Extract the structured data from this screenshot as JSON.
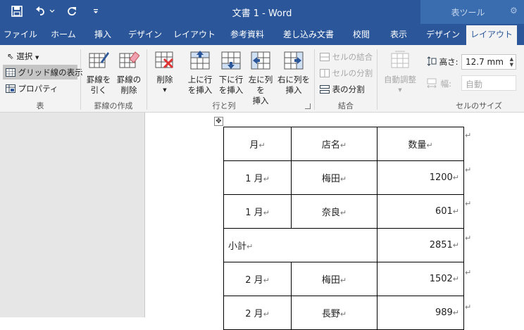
{
  "titlebar": {
    "doc_title": "文書 1 - Word",
    "context_title": "表ツール"
  },
  "tabs": [
    {
      "label": "ファイル"
    },
    {
      "label": "ホーム"
    },
    {
      "label": "挿入"
    },
    {
      "label": "デザイン"
    },
    {
      "label": "レイアウト"
    },
    {
      "label": "参考資料"
    },
    {
      "label": "差し込み文書"
    },
    {
      "label": "校閲"
    },
    {
      "label": "表示"
    },
    {
      "label": "デザイン"
    },
    {
      "label": "レイアウト"
    }
  ],
  "ribbon": {
    "table_group": {
      "select": "選択",
      "gridlines": "グリッド線の表示",
      "properties": "プロパティ",
      "label": "表"
    },
    "draw_group": {
      "draw_line": [
        "罫線を",
        "引く"
      ],
      "erase_line": [
        "罫線の",
        "削除"
      ],
      "label": "罫線の作成"
    },
    "rows_cols_group": {
      "delete": "削除",
      "insert_above": [
        "上に行",
        "を挿入"
      ],
      "insert_below": [
        "下に行",
        "を挿入"
      ],
      "insert_left": [
        "左に列を",
        "挿入"
      ],
      "insert_right": [
        "右に列を",
        "挿入"
      ],
      "label": "行と列"
    },
    "merge_group": {
      "merge_cells": "セルの結合",
      "split_cells": "セルの分割",
      "split_table": "表の分割",
      "label": "結合"
    },
    "cell_size_group": {
      "autofit": "自動調整",
      "height_label": "高さ:",
      "height_value": "12.7 mm",
      "width_label": "幅:",
      "width_value": "自動",
      "label": "セルのサイズ"
    }
  },
  "document": {
    "table": {
      "header": [
        "月",
        "店名",
        "数量"
      ],
      "rows": [
        {
          "month": "1 月",
          "store": "梅田",
          "qty": "1200"
        },
        {
          "month": "1 月",
          "store": "奈良",
          "qty": "601"
        },
        {
          "subtotal_label": "小計",
          "qty": "2851"
        },
        {
          "month": "2 月",
          "store": "梅田",
          "qty": "1502"
        },
        {
          "month": "2 月",
          "store": "長野",
          "qty": "989"
        }
      ]
    },
    "marks": {
      "cell": "↵",
      "row": "↵"
    }
  },
  "colors": {
    "word_blue": "#2b579a",
    "context_blue": "#3a6db0",
    "ribbon_bg": "#f3f3f3",
    "canvas_gray": "#e6e6e6"
  }
}
